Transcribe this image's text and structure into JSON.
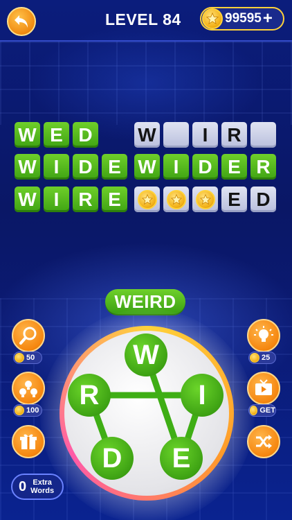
{
  "header": {
    "level_label": "LEVEL 84",
    "coins": "99595",
    "plus": "+"
  },
  "board": {
    "rows": [
      {
        "words": [
          {
            "tiles": [
              {
                "t": "W",
                "state": "solved"
              },
              {
                "t": "E",
                "state": "solved"
              },
              {
                "t": "D",
                "state": "solved"
              }
            ]
          },
          {
            "tiles": [
              {
                "t": "W",
                "state": "revealed"
              },
              {
                "t": "",
                "state": "empty"
              },
              {
                "t": "I",
                "state": "revealed"
              },
              {
                "t": "R",
                "state": "revealed"
              },
              {
                "t": "",
                "state": "empty"
              }
            ]
          }
        ]
      },
      {
        "words": [
          {
            "tiles": [
              {
                "t": "W",
                "state": "solved"
              },
              {
                "t": "I",
                "state": "solved"
              },
              {
                "t": "D",
                "state": "solved"
              },
              {
                "t": "E",
                "state": "solved"
              }
            ]
          },
          {
            "tiles": [
              {
                "t": "W",
                "state": "solved"
              },
              {
                "t": "I",
                "state": "solved"
              },
              {
                "t": "D",
                "state": "solved"
              },
              {
                "t": "E",
                "state": "solved"
              },
              {
                "t": "R",
                "state": "solved"
              }
            ]
          }
        ]
      },
      {
        "words": [
          {
            "tiles": [
              {
                "t": "W",
                "state": "solved"
              },
              {
                "t": "I",
                "state": "solved"
              },
              {
                "t": "R",
                "state": "solved"
              },
              {
                "t": "E",
                "state": "solved"
              }
            ]
          },
          {
            "tiles": [
              {
                "t": "",
                "state": "coin"
              },
              {
                "t": "",
                "state": "coin"
              },
              {
                "t": "",
                "state": "coin"
              },
              {
                "t": "E",
                "state": "revealed"
              },
              {
                "t": "D",
                "state": "revealed"
              }
            ]
          }
        ]
      }
    ]
  },
  "current_word": "WEIRD",
  "tools": {
    "hint": {
      "icon": "magnifier-icon",
      "cost": "50"
    },
    "multi_hint": {
      "icon": "multi-bulb-icon",
      "cost": "100"
    },
    "gift": {
      "icon": "gift-icon"
    },
    "light": {
      "icon": "bulb-icon",
      "cost": "25"
    },
    "video": {
      "icon": "video-icon",
      "cost": "GET"
    },
    "shuffle": {
      "icon": "shuffle-icon"
    }
  },
  "extra_words": {
    "count": "0",
    "label_line1": "Extra",
    "label_line2": "Words"
  },
  "wheel": {
    "letters": [
      "W",
      "R",
      "I",
      "D",
      "E"
    ],
    "path": [
      "W",
      "E",
      "I",
      "R",
      "D"
    ]
  },
  "colors": {
    "tile_green": "#4cb51c",
    "tile_slot": "#c9cde6",
    "accent_orange": "#f5860f",
    "background": "#0a1a6e"
  }
}
